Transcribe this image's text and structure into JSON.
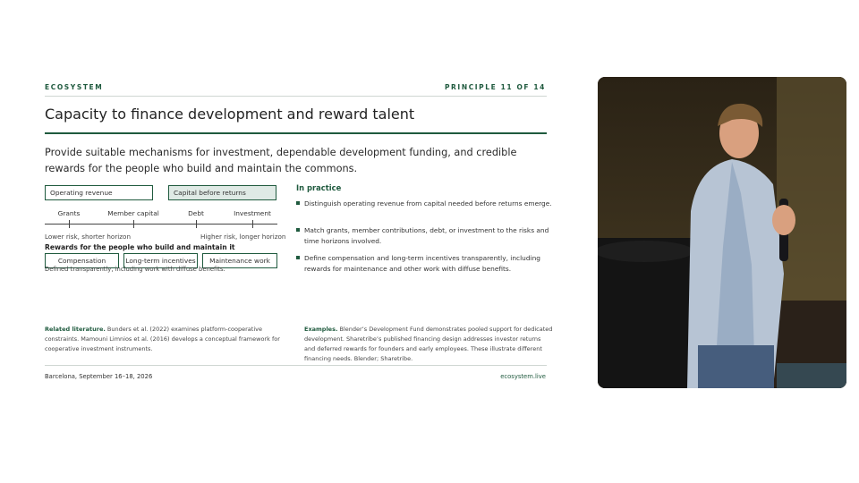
{
  "slide": {
    "section_label": "ECOSYSTEM",
    "principle_label": "PRINCIPLE 11 OF 14",
    "title": "Capacity to finance development and reward talent",
    "lead": "Provide suitable mechanisms for investment, dependable development funding, and credible rewards for the people who build and maintain the commons.",
    "diagram": {
      "box_left": "Operating revenue",
      "box_right": "Capital before returns",
      "scale_labels": [
        "Grants",
        "Member capital",
        "Debt",
        "Investment"
      ],
      "scale_low": "Lower risk, shorter horizon",
      "scale_high": "Higher risk, longer horizon",
      "rewards_heading": "Rewards for the people who build and maintain it",
      "rewards": [
        "Compensation",
        "Long-term incentives",
        "Maintenance work"
      ],
      "rewards_note": "Defined transparently, including work with diffuse benefits."
    },
    "in_practice": {
      "heading": "In practice",
      "items": [
        "Distinguish operating revenue from capital needed before returns emerge.",
        "Match grants, member contributions, debt, or investment to the risks and time horizons involved.",
        "Define compensation and long-term incentives transparently, including rewards for maintenance and other work with diffuse benefits."
      ]
    },
    "related": {
      "label": "Related literature.",
      "text": "Bunders et al. (2022) examines platform-cooperative constraints. Mamouni Limnios et al. (2016) develops a conceptual framework for cooperative investment instruments."
    },
    "examples": {
      "label": "Examples.",
      "text": "Blender’s Development Fund demonstrates pooled support for dedicated development. Sharetribe’s published financing design addresses investor returns and deferred rewards for founders and early employees. These illustrate different financing needs. Blender; Sharetribe."
    },
    "footer_left": "Barcelona, September 16–18, 2026",
    "footer_right": "ecosystem.live"
  },
  "colors": {
    "accent": "#1f5a3e",
    "accent_fill": "#dfeae5"
  }
}
